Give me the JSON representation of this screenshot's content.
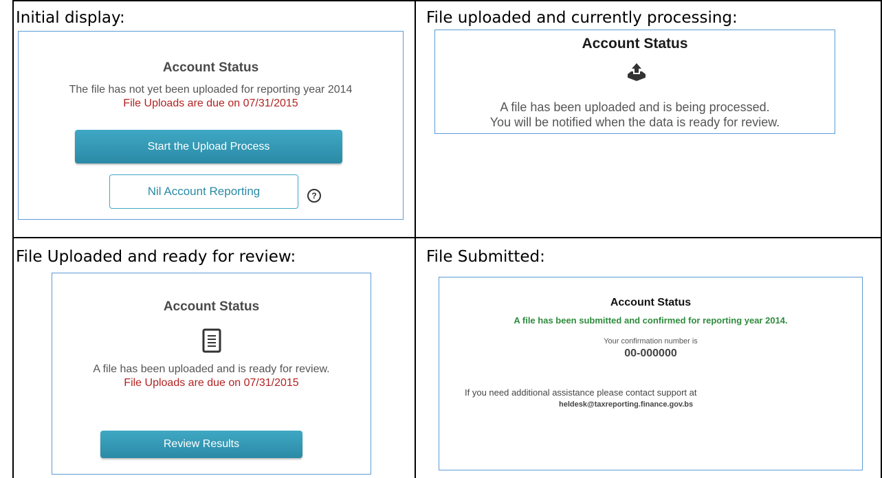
{
  "cells": {
    "initial": {
      "title": "Initial display:",
      "heading": "Account Status",
      "message": "The file has not yet been uploaded for reporting year 2014",
      "due": "File Uploads are due on 07/31/2015",
      "start_button": "Start the Upload Process",
      "nil_button": "Nil Account Reporting",
      "help": "?"
    },
    "processing": {
      "title": "File uploaded and currently processing:",
      "heading": "Account Status",
      "line1": "A file has been uploaded and is being processed.",
      "line2": "You will be notified when the data is ready for review."
    },
    "review": {
      "title": "File Uploaded and ready for review:",
      "heading": "Account Status",
      "message": "A file has been uploaded and is ready for review.",
      "due": "File Uploads are due on 07/31/2015",
      "button": "Review Results"
    },
    "submitted": {
      "title": "File Submitted:",
      "heading": "Account Status",
      "confirmed": "A file has been submitted and confirmed for reporting year 2014.",
      "conf_label": "Your confirmation number is",
      "conf_number": "00-000000",
      "support": "If you need additional assistance please contact support at",
      "email": "heldesk@taxreporting.finance.gov.bs"
    }
  },
  "colors": {
    "panel_border": "#5b9bd5",
    "button": "#2b8aa6",
    "due_red": "#b22222",
    "confirmed_green": "#2e8b3d"
  },
  "icons": [
    "upload-tray-icon",
    "document-icon",
    "help-circle-icon"
  ]
}
